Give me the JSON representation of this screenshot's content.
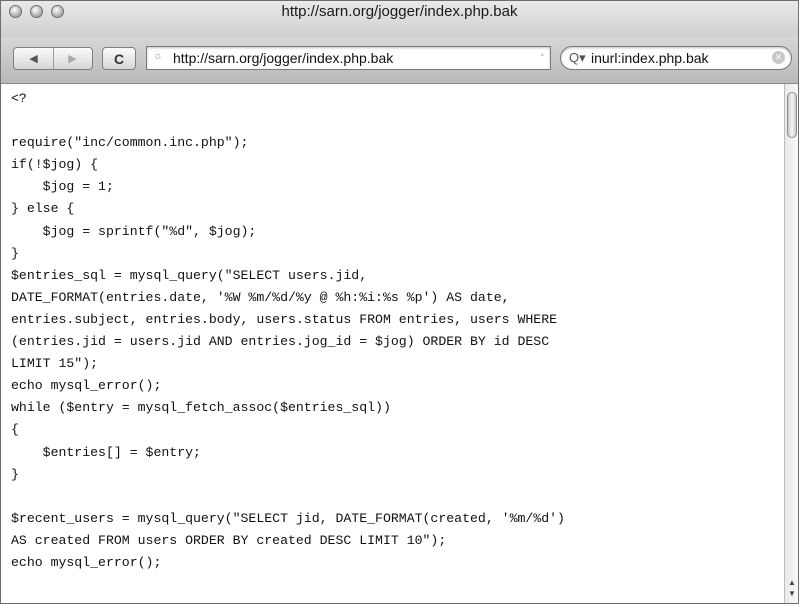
{
  "window": {
    "title": "http://sarn.org/jogger/index.php.bak"
  },
  "toolbar": {
    "back_icon": "◀",
    "forward_icon": "▶",
    "reload_icon": "C",
    "url_value": "http://sarn.org/jogger/index.php.bak",
    "search_value": "inurl:index.php.bak"
  },
  "content": {
    "code": "<?\n\nrequire(\"inc/common.inc.php\");\nif(!$jog) {\n    $jog = 1;\n} else {\n    $jog = sprintf(\"%d\", $jog);\n}\n$entries_sql = mysql_query(\"SELECT users.jid,\nDATE_FORMAT(entries.date, '%W %m/%d/%y @ %h:%i:%s %p') AS date,\nentries.subject, entries.body, users.status FROM entries, users WHERE\n(entries.jid = users.jid AND entries.jog_id = $jog) ORDER BY id DESC\nLIMIT 15\");\necho mysql_error();\nwhile ($entry = mysql_fetch_assoc($entries_sql))\n{\n    $entries[] = $entry;\n}\n\n$recent_users = mysql_query(\"SELECT jid, DATE_FORMAT(created, '%m/%d')\nAS created FROM users ORDER BY created DESC LIMIT 10\");\necho mysql_error();"
  }
}
